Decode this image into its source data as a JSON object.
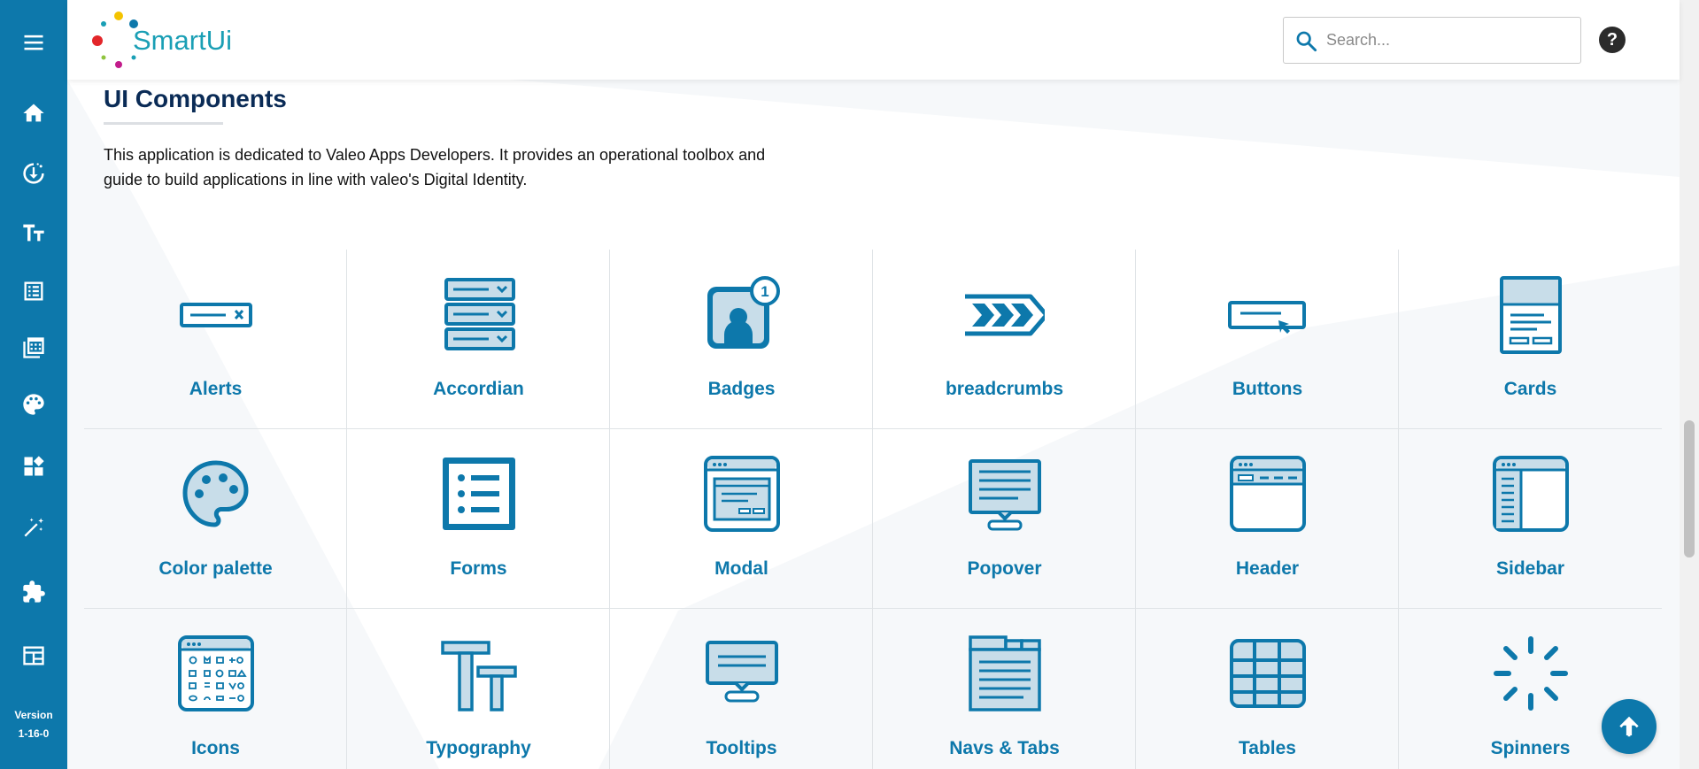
{
  "sidebar": {
    "menu_icon": "hamburger-icon",
    "items": [
      {
        "name": "home",
        "icon": "home-icon"
      },
      {
        "name": "download",
        "icon": "download-icon"
      },
      {
        "name": "typography",
        "icon": "text-size-icon"
      },
      {
        "name": "forms",
        "icon": "list-form-icon"
      },
      {
        "name": "layouts",
        "icon": "stacked-layers-icon"
      },
      {
        "name": "colors",
        "icon": "palette-icon"
      },
      {
        "name": "components",
        "icon": "widgets-icon"
      },
      {
        "name": "magic",
        "icon": "magic-wand-icon"
      },
      {
        "name": "extensions",
        "icon": "puzzle-icon"
      },
      {
        "name": "templates",
        "icon": "table-layout-icon"
      }
    ],
    "version_label": "Version",
    "version_value": "1-16-0"
  },
  "header": {
    "logo_smart": "Smart",
    "logo_ui": "Ui",
    "search_placeholder": "Search...",
    "help_label": "?"
  },
  "main": {
    "title": "UI Components",
    "description": "This application is dedicated to Valeo Apps Developers. It provides an operational toolbox and guide to build applications in line with valeo's Digital Identity.",
    "components": [
      {
        "label": "Alerts",
        "icon": "alert-icon"
      },
      {
        "label": "Accordian",
        "icon": "accordion-icon"
      },
      {
        "label": "Badges",
        "icon": "badge-icon"
      },
      {
        "label": "breadcrumbs",
        "icon": "breadcrumb-icon"
      },
      {
        "label": "Buttons",
        "icon": "button-icon"
      },
      {
        "label": "Cards",
        "icon": "card-icon"
      },
      {
        "label": "Color palette",
        "icon": "palette-icon"
      },
      {
        "label": "Forms",
        "icon": "form-icon"
      },
      {
        "label": "Modal",
        "icon": "modal-icon"
      },
      {
        "label": "Popover",
        "icon": "popover-icon"
      },
      {
        "label": "Header",
        "icon": "header-icon"
      },
      {
        "label": "Sidebar",
        "icon": "sidebar-icon"
      },
      {
        "label": "Icons",
        "icon": "icons-grid-icon"
      },
      {
        "label": "Typography",
        "icon": "typography-icon"
      },
      {
        "label": "Tooltips",
        "icon": "tooltip-icon"
      },
      {
        "label": "Navs & Tabs",
        "icon": "tabs-icon"
      },
      {
        "label": "Tables",
        "icon": "table-icon"
      },
      {
        "label": "Spinners",
        "icon": "spinner-icon"
      }
    ],
    "badge_count": "1"
  },
  "colors": {
    "brand_blue": "#0d78ab",
    "title_navy": "#0a2b56",
    "icon_fill_light": "#c8dde9"
  }
}
